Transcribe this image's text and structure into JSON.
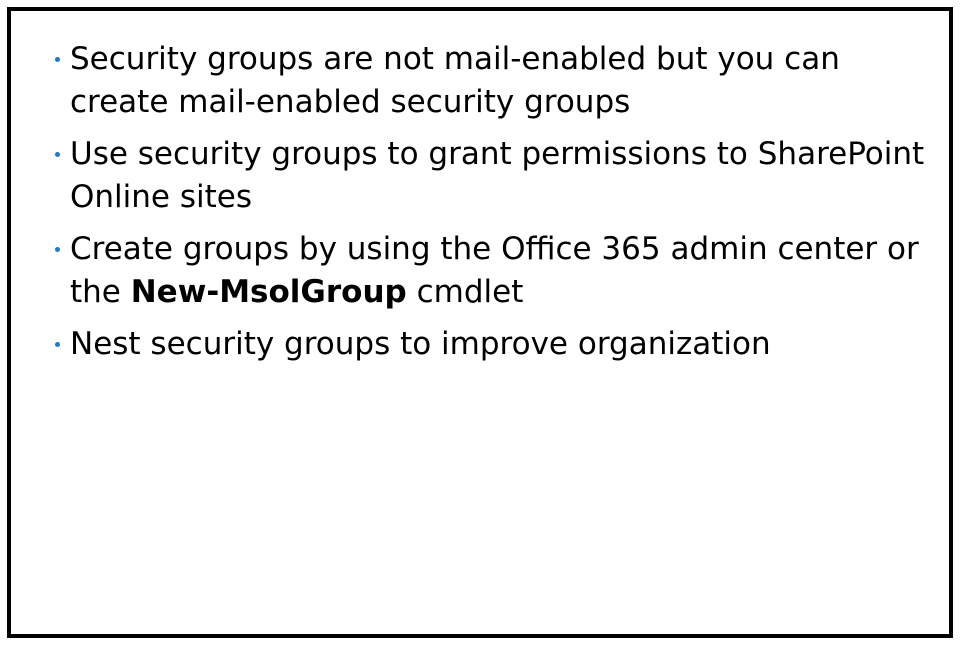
{
  "colors": {
    "bullet": "#1f7ac4",
    "text": "#000000",
    "border": "#000000",
    "background": "#ffffff"
  },
  "bullets": [
    {
      "text": "Security groups are not mail-enabled but you can create mail-enabled security groups"
    },
    {
      "text": "Use security groups to grant permissions to SharePoint Online sites"
    },
    {
      "text_before": "Create groups by using the Office 365 admin center or the ",
      "bold": "New-MsolGroup",
      "text_after": " cmdlet"
    },
    {
      "text": "Nest security groups to improve organization"
    }
  ]
}
